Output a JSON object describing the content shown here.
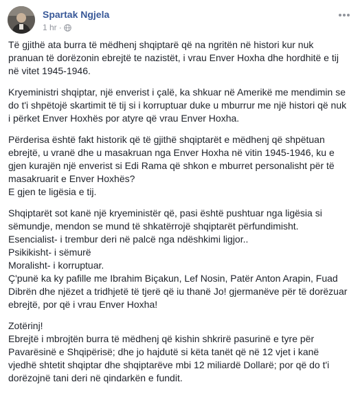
{
  "post": {
    "author": "Spartak Ngjela",
    "time": "1 hr",
    "separator": "·",
    "paragraphs": [
      [
        "Të gjithë ata burra të mëdhenj shqiptarë që na ngritën në histori kur nuk pranuan të dorëzonin ebrejtë te nazistët, i vrau Enver Hoxha dhe hordhitë e tij në vitet 1945-1946."
      ],
      [
        "Kryeministri shqiptar, një enverist i çalë, ka shkuar në Amerikë me mendimin se do t'i shpëtojë skartimit të tij si i korruptuar duke u mburrur me një histori që nuk i përket Enver Hoxhës por atyre që vrau Enver Hoxha."
      ],
      [
        "Përderisa është fakt historik që të gjithë shqiptarët e mëdhenj që shpëtuan ebrejtë, u vranë dhe u masakruan nga Enver Hoxha në vitin 1945-1946, ku e gjen kurajën një enverist si Edi Rama që shkon e mburret personalisht për të masakruarit e Enver Hoxhës?",
        "E gjen te ligësia e tij."
      ],
      [
        "Shqiptarët sot kanë një kryeministër që, pasi është pushtuar nga ligësia si sëmundje, mendon se mund të shkatërrojë shqiptarët përfundimisht.",
        "Esencialist- i trembur deri në palcë nga ndëshkimi ligjor..",
        "Psikikisht- i sëmurë",
        "Moralisht- i korruptuar.",
        "Ç'punë ka ky pafille me Ibrahim Biçakun, Lef Nosin, Patër Anton Arapin, Fuad Dibrën dhe njëzet a tridhjetë të tjerë që iu thanë Jo! gjermanëve për të dorëzuar ebrejtë, por që i vrau Enver Hoxha!"
      ],
      [
        "Zotërinj!",
        "Ebrejtë i mbrojtën burra të mëdhenj që kishin shkrirë pasurinë e tyre për Pavarësinë e Shqipërisë; dhe jo hajdutë si këta tanët që në 12 vjet i kanë vjedhë shtetit shqiptar dhe shqiptarëve mbi 12 miliardë Dollarë; por që do t'i dorëzojnë tani deri në qindarkën e fundit."
      ]
    ]
  },
  "icons": {
    "privacy": "globe-icon",
    "menu": "more-options-icon",
    "avatar": "profile-photo"
  },
  "colors": {
    "author_link": "#385898",
    "meta_text": "#90949c",
    "body_text": "#1d2129"
  }
}
